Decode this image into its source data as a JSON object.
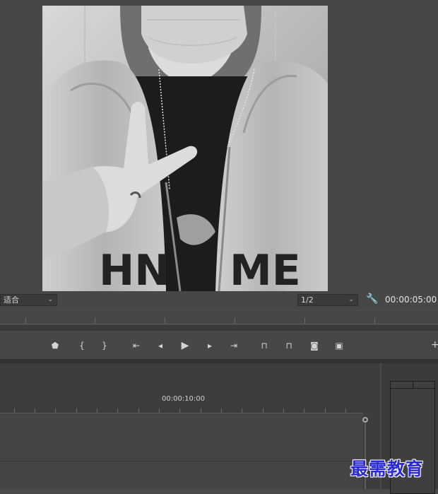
{
  "monitor": {
    "zoom_label": "适合",
    "resolution_label": "1/2",
    "timecode": "00:00:05:00"
  },
  "transport": {
    "buttons": [
      {
        "name": "add-marker",
        "glyph": "⬟"
      },
      {
        "name": "mark-in",
        "glyph": "{"
      },
      {
        "name": "mark-out",
        "glyph": "}"
      },
      {
        "name": "go-to-in",
        "glyph": "⇤"
      },
      {
        "name": "step-back",
        "glyph": "◂"
      },
      {
        "name": "play",
        "glyph": "▶"
      },
      {
        "name": "step-forward",
        "glyph": "▸"
      },
      {
        "name": "go-to-out",
        "glyph": "⇥"
      },
      {
        "name": "lift",
        "glyph": "⊓"
      },
      {
        "name": "extract",
        "glyph": "⊓"
      },
      {
        "name": "export-frame",
        "glyph": "◙"
      },
      {
        "name": "comparison-view",
        "glyph": "▣"
      }
    ],
    "plus": "+"
  },
  "timeline": {
    "ruler_time": "00:00:10:00"
  },
  "watermark": "最需教育"
}
